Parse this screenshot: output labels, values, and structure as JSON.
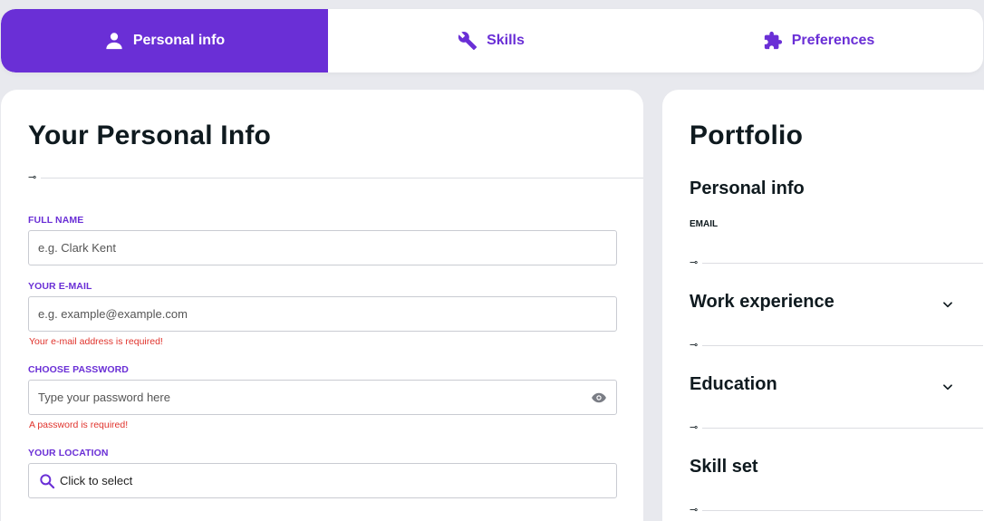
{
  "tabs": [
    {
      "label": "Personal info",
      "icon": "user-icon",
      "active": true
    },
    {
      "label": "Skills",
      "icon": "wrench-icon",
      "active": false
    },
    {
      "label": "Preferences",
      "icon": "puzzle-icon",
      "active": false
    }
  ],
  "form": {
    "title": "Your Personal Info",
    "full_name": {
      "label": "FULL NAME",
      "placeholder": "e.g. Clark Kent",
      "value": ""
    },
    "email": {
      "label": "YOUR E-MAIL",
      "placeholder": "e.g. example@example.com",
      "value": "",
      "error": "Your e-mail address is required!"
    },
    "password": {
      "label": "CHOOSE PASSWORD",
      "placeholder": "Type your password here",
      "value": "",
      "error": "A password is required!"
    },
    "location": {
      "label": "YOUR LOCATION",
      "value": "Click to select"
    }
  },
  "portfolio": {
    "title": "Portfolio",
    "personal_info": {
      "heading": "Personal info",
      "email_label": "EMAIL"
    },
    "work_experience": {
      "heading": "Work experience"
    },
    "education": {
      "heading": "Education"
    },
    "skill_set": {
      "heading": "Skill set"
    }
  },
  "colors": {
    "accent": "#6a2fd6",
    "error": "#e0332c",
    "background": "#e8e9ee"
  }
}
